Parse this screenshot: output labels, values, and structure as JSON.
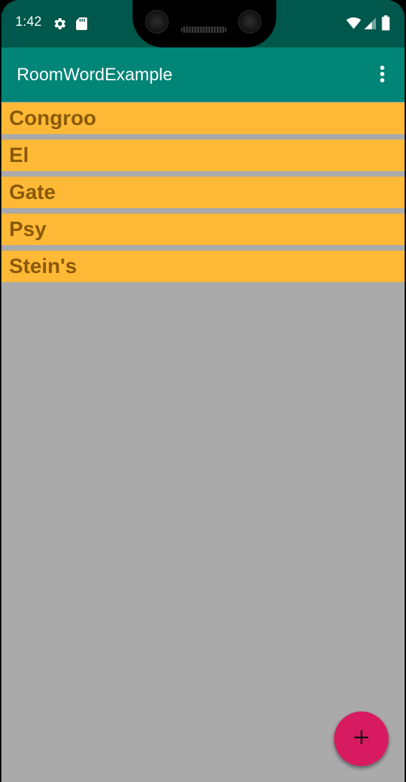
{
  "status_bar": {
    "time": "1:42",
    "icons": [
      "settings-icon",
      "sd-card-icon",
      "wifi-icon",
      "signal-icon",
      "battery-icon"
    ],
    "background": "#00574b"
  },
  "app_bar": {
    "title": "RoomWordExample",
    "overflow_icon": "more-vert-icon",
    "background": "#008577"
  },
  "words": {
    "items": [
      {
        "label": "Congroo"
      },
      {
        "label": "El"
      },
      {
        "label": "Gate"
      },
      {
        "label": "Psy"
      },
      {
        "label": "Stein's"
      }
    ],
    "item_background": "#ffb936",
    "text_color": "#8a5a08",
    "list_background": "#aaaaaa"
  },
  "fab": {
    "icon": "plus-icon",
    "color": "#d81b60"
  }
}
